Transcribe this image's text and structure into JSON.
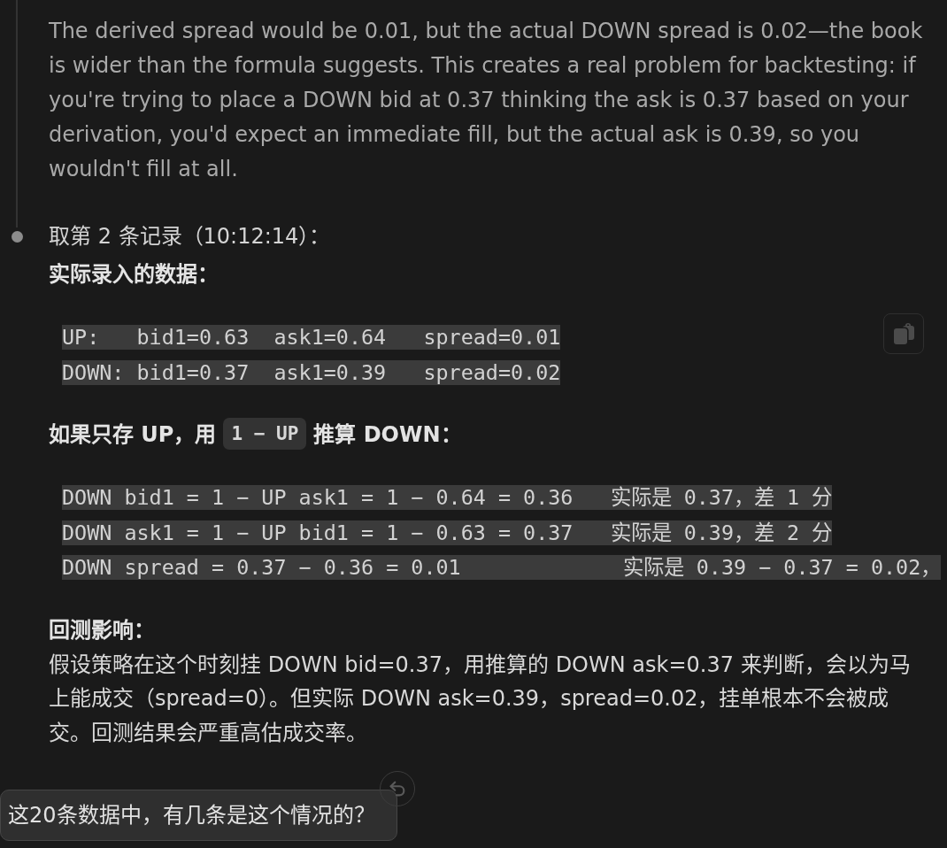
{
  "thinking": {
    "text": "The derived spread would be 0.01, but the actual DOWN spread is 0.02—the book is wider than the formula suggests. This creates a real problem for backtesting: if you're trying to place a DOWN bid at 0.37 thinking the ask is 0.37 based on your derivation, you'd expect an immediate fill, but the actual ask is 0.39, so you wouldn't fill at all."
  },
  "step": {
    "title": "取第 2 条记录（10:12:14）："
  },
  "blocks": [
    {
      "kind": "heading",
      "parts": [
        {
          "kind": "text",
          "text": "实际录入的数据："
        }
      ]
    },
    {
      "kind": "code",
      "copy_button": true,
      "lines": [
        "UP:   bid1=0.63  ask1=0.64   spread=0.01",
        "DOWN: bid1=0.37  ask1=0.39   spread=0.02"
      ]
    },
    {
      "kind": "heading",
      "parts": [
        {
          "kind": "text",
          "text": "如果只存 UP，用"
        },
        {
          "kind": "code",
          "text": "1 − UP"
        },
        {
          "kind": "text",
          "text": "推算 DOWN："
        }
      ]
    },
    {
      "kind": "code",
      "copy_button": false,
      "lines": [
        "DOWN bid1 = 1 − UP ask1 = 1 − 0.64 = 0.36   实际是 0.37，差 1 分",
        "DOWN ask1 = 1 − UP bid1 = 1 − 0.63 = 0.37   实际是 0.39，差 2 分",
        "DOWN spread = 0.37 − 0.36 = 0.01             实际是 0.39 − 0.37 = 0.02，"
      ]
    },
    {
      "kind": "heading",
      "parts": [
        {
          "kind": "text",
          "text": "回测影响："
        }
      ]
    },
    {
      "kind": "paragraph",
      "text": "假设策略在这个时刻挂 DOWN bid=0.37，用推算的 DOWN ask=0.37 来判断，会以为马上能成交（spread=0）。但实际 DOWN ask=0.39，spread=0.02，挂单根本不会被成交。回测结果会严重高估成交率。"
    }
  ],
  "user_message": {
    "text": "这20条数据中，有几条是这个情况的？"
  }
}
